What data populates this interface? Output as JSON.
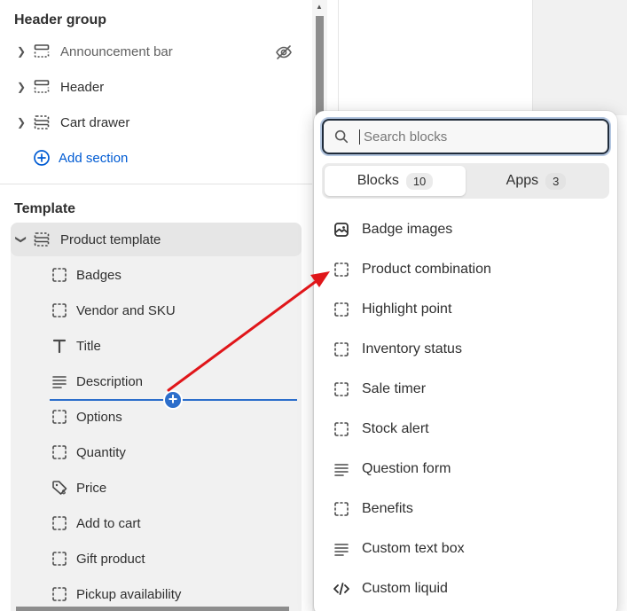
{
  "header_group": {
    "title": "Header group",
    "items": [
      {
        "label": "Announcement bar",
        "icon": "section-icon",
        "hidden": true
      },
      {
        "label": "Header",
        "icon": "section-icon"
      },
      {
        "label": "Cart drawer",
        "icon": "section-icon"
      }
    ],
    "add_section_label": "Add section"
  },
  "template": {
    "title": "Template",
    "product_template_label": "Product template",
    "children": [
      {
        "label": "Badges",
        "icon": "block-icon"
      },
      {
        "label": "Vendor and SKU",
        "icon": "block-icon"
      },
      {
        "label": "Title",
        "icon": "text-icon"
      },
      {
        "label": "Description",
        "icon": "paragraph-icon"
      },
      {
        "label": "Options",
        "icon": "block-icon"
      },
      {
        "label": "Quantity",
        "icon": "block-icon"
      },
      {
        "label": "Price",
        "icon": "price-tag-icon"
      },
      {
        "label": "Add to cart",
        "icon": "block-icon"
      },
      {
        "label": "Gift product",
        "icon": "block-icon"
      },
      {
        "label": "Pickup availability",
        "icon": "block-icon"
      }
    ]
  },
  "popover": {
    "search_placeholder": "Search blocks",
    "tabs": [
      {
        "label": "Blocks",
        "count": "10",
        "active": true
      },
      {
        "label": "Apps",
        "count": "3",
        "active": false
      }
    ],
    "blocks": [
      {
        "label": "Badge images",
        "icon": "image-icon"
      },
      {
        "label": "Product combination",
        "icon": "block-icon"
      },
      {
        "label": "Highlight point",
        "icon": "block-icon"
      },
      {
        "label": "Inventory status",
        "icon": "block-icon"
      },
      {
        "label": "Sale timer",
        "icon": "block-icon"
      },
      {
        "label": "Stock alert",
        "icon": "block-icon"
      },
      {
        "label": "Question form",
        "icon": "paragraph-icon"
      },
      {
        "label": "Benefits",
        "icon": "block-icon"
      },
      {
        "label": "Custom text box",
        "icon": "paragraph-icon"
      },
      {
        "label": "Custom liquid",
        "icon": "code-icon"
      }
    ]
  },
  "colors": {
    "accent": "#005bd3",
    "insert_line": "#2c6ecb",
    "annotation_arrow": "#e0161a"
  }
}
